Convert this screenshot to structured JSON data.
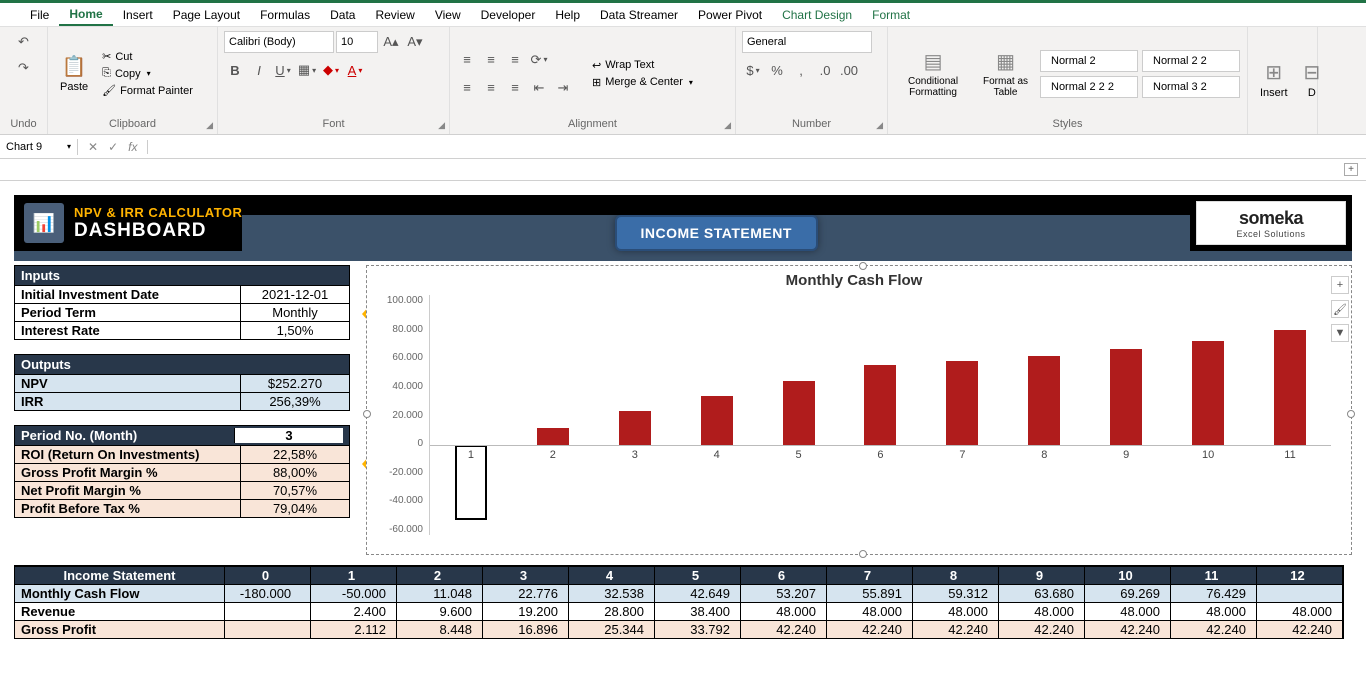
{
  "menu": [
    "File",
    "Home",
    "Insert",
    "Page Layout",
    "Formulas",
    "Data",
    "Review",
    "View",
    "Developer",
    "Help",
    "Data Streamer",
    "Power Pivot",
    "Chart Design",
    "Format"
  ],
  "ribbon": {
    "undo_label": "Undo",
    "clipboard": {
      "paste": "Paste",
      "cut": "Cut",
      "copy": "Copy",
      "painter": "Format Painter",
      "label": "Clipboard"
    },
    "font": {
      "name": "Calibri (Body)",
      "size": "10",
      "label": "Font"
    },
    "alignment": {
      "wrap": "Wrap Text",
      "merge": "Merge & Center",
      "label": "Alignment"
    },
    "number": {
      "format": "General",
      "label": "Number"
    },
    "styles": {
      "cond": "Conditional Formatting",
      "table": "Format as Table",
      "n2": "Normal 2",
      "n22": "Normal 2 2",
      "n222": "Normal 2 2 2",
      "n32": "Normal 3 2",
      "label": "Styles"
    },
    "cells": {
      "insert": "Insert",
      "delete": "D"
    }
  },
  "namebox": "Chart 9",
  "banner": {
    "title1": "NPV & IRR CALCULATOR",
    "title2": "DASHBOARD",
    "button": "INCOME STATEMENT",
    "brand": "someka",
    "brand_sub": "Excel Solutions"
  },
  "inputs": {
    "header": "Inputs",
    "rows": [
      {
        "lbl": "Initial Investment Date",
        "val": "2021-12-01"
      },
      {
        "lbl": "Period Term",
        "val": "Monthly"
      },
      {
        "lbl": "Interest Rate",
        "val": "1,50%"
      }
    ]
  },
  "outputs": {
    "header": "Outputs",
    "rows": [
      {
        "lbl": "NPV",
        "val": "$252.270"
      },
      {
        "lbl": "IRR",
        "val": "256,39%"
      }
    ]
  },
  "period": {
    "header": "Period No. (Month)",
    "header_val": "3",
    "rows": [
      {
        "lbl": "ROI (Return On Investments)",
        "val": "22,58%"
      },
      {
        "lbl": "Gross Profit Margin %",
        "val": "88,00%"
      },
      {
        "lbl": "Net Profit Margin %",
        "val": "70,57%"
      },
      {
        "lbl": "Profit Before Tax %",
        "val": "79,04%"
      }
    ]
  },
  "chart_data": {
    "type": "bar",
    "title": "Monthly Cash Flow",
    "categories": [
      "1",
      "2",
      "3",
      "4",
      "5",
      "6",
      "7",
      "8",
      "9",
      "10",
      "11"
    ],
    "values": [
      -50000,
      11048,
      22776,
      32538,
      42649,
      53207,
      55891,
      59312,
      63680,
      69269,
      76429
    ],
    "ylim": [
      -60000,
      100000
    ],
    "yticks": [
      "100.000",
      "80.000",
      "60.000",
      "40.000",
      "20.000",
      "0",
      "-20.000",
      "-40.000",
      "-60.000"
    ]
  },
  "income_statement": {
    "header": "Income Statement",
    "cols": [
      "0",
      "1",
      "2",
      "3",
      "4",
      "5",
      "6",
      "7",
      "8",
      "9",
      "10",
      "11",
      "12"
    ],
    "rows": [
      {
        "lbl": "Monthly Cash Flow",
        "vals": [
          "-180.000",
          "-50.000",
          "11.048",
          "22.776",
          "32.538",
          "42.649",
          "53.207",
          "55.891",
          "59.312",
          "63.680",
          "69.269",
          "76.429",
          ""
        ],
        "cls": "row-bg-blue"
      },
      {
        "lbl": "Revenue",
        "vals": [
          "",
          "2.400",
          "9.600",
          "19.200",
          "28.800",
          "38.400",
          "48.000",
          "48.000",
          "48.000",
          "48.000",
          "48.000",
          "48.000",
          "48.000"
        ],
        "cls": ""
      },
      {
        "lbl": "Gross Profit",
        "vals": [
          "",
          "2.112",
          "8.448",
          "16.896",
          "25.344",
          "33.792",
          "42.240",
          "42.240",
          "42.240",
          "42.240",
          "42.240",
          "42.240",
          "42.240"
        ],
        "cls": "row-bg-peach"
      }
    ]
  }
}
